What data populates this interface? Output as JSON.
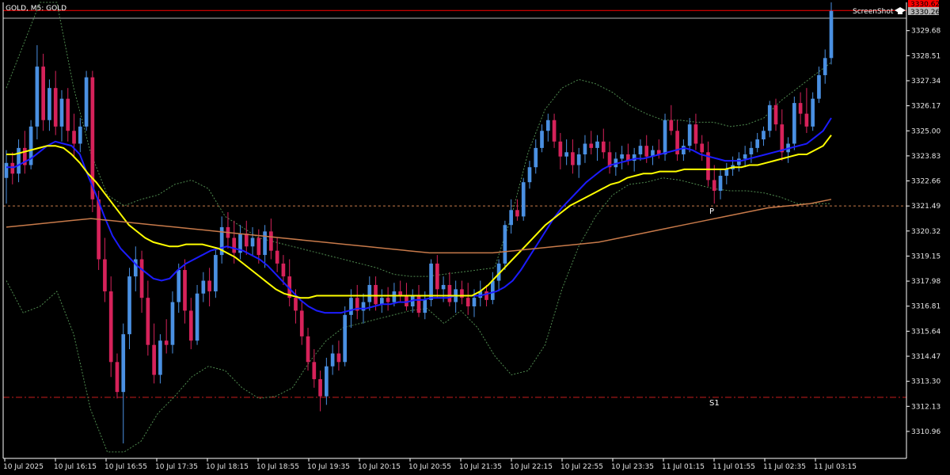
{
  "symbol_label": "GOLD, M5:  GOLD",
  "brand_label": "ScreenShot",
  "icon": "graduation-cap-icon",
  "colors": {
    "background": "#000000",
    "bull": "#4a90e2",
    "bear": "#d6225a",
    "axis": "#ffffff",
    "ma_fast": "#1c1cff",
    "ma_slow": "#ffff00",
    "ma_long": "#c87a4a",
    "bollinger": "#4f8a4f",
    "level_p": "#c87a4a",
    "level_s1": "#c81e1e",
    "bid_line": "#b4b4b4",
    "ask_line": "#ff0000"
  },
  "current_price": {
    "bid": "3330.26",
    "ask": "3330.62"
  },
  "chart_data": {
    "type": "candlestick",
    "instrument": "GOLD",
    "timeframe": "M5",
    "y_ticks": [
      "3329.68",
      "3328.51",
      "3327.34",
      "3326.17",
      "3325.00",
      "3323.83",
      "3322.66",
      "3321.49",
      "3320.32",
      "3319.15",
      "3317.98",
      "3316.81",
      "3315.64",
      "3314.47",
      "3313.30",
      "3312.13",
      "3310.96"
    ],
    "ylim": [
      3309.7,
      3331.0
    ],
    "x_ticks": [
      "10 Jul 2025",
      "10 Jul 16:15",
      "10 Jul 16:55",
      "10 Jul 17:35",
      "10 Jul 18:15",
      "10 Jul 18:55",
      "10 Jul 19:35",
      "10 Jul 20:15",
      "10 Jul 20:55",
      "10 Jul 21:35",
      "10 Jul 22:15",
      "10 Jul 22:55",
      "10 Jul 23:35",
      "11 Jul 01:15",
      "11 Jul 01:55",
      "11 Jul 02:35",
      "11 Jul 03:15"
    ],
    "levels": [
      {
        "label": "P",
        "value": 3321.49,
        "style": "dashed"
      },
      {
        "label": "S1",
        "value": 3312.55,
        "style": "dashdot"
      }
    ],
    "candles": [
      [
        3322.8,
        3324.1,
        3321.6,
        3323.5
      ],
      [
        3323.5,
        3324.0,
        3322.5,
        3323.0
      ],
      [
        3323.0,
        3324.6,
        3322.6,
        3324.2
      ],
      [
        3324.2,
        3325.0,
        3323.0,
        3323.4
      ],
      [
        3323.4,
        3325.5,
        3323.2,
        3325.2
      ],
      [
        3325.2,
        3329.0,
        3324.6,
        3328.0
      ],
      [
        3328.0,
        3328.6,
        3325.0,
        3325.5
      ],
      [
        3325.5,
        3327.4,
        3325.0,
        3327.0
      ],
      [
        3327.0,
        3327.8,
        3324.8,
        3325.2
      ],
      [
        3325.2,
        3326.9,
        3324.5,
        3326.5
      ],
      [
        3326.5,
        3327.0,
        3324.5,
        3325.0
      ],
      [
        3325.0,
        3325.8,
        3323.8,
        3324.4
      ],
      [
        3324.4,
        3325.6,
        3324.0,
        3325.2
      ],
      [
        3325.2,
        3327.8,
        3325.0,
        3327.5
      ],
      [
        3327.5,
        3327.8,
        3321.2,
        3321.8
      ],
      [
        3321.8,
        3322.2,
        3318.5,
        3319.0
      ],
      [
        3319.0,
        3320.0,
        3317.0,
        3317.5
      ],
      [
        3317.5,
        3318.2,
        3313.5,
        3314.2
      ],
      [
        3314.2,
        3314.6,
        3312.5,
        3312.8
      ],
      [
        3312.8,
        3316.0,
        3310.4,
        3315.5
      ],
      [
        3315.5,
        3318.6,
        3314.8,
        3318.2
      ],
      [
        3318.2,
        3319.6,
        3317.5,
        3319.0
      ],
      [
        3319.0,
        3319.4,
        3316.5,
        3317.2
      ],
      [
        3317.2,
        3318.0,
        3314.5,
        3315.0
      ],
      [
        3315.0,
        3316.0,
        3313.2,
        3313.6
      ],
      [
        3313.6,
        3315.5,
        3313.2,
        3315.2
      ],
      [
        3315.2,
        3316.2,
        3314.6,
        3315.0
      ],
      [
        3315.0,
        3317.5,
        3314.6,
        3317.0
      ],
      [
        3317.0,
        3318.8,
        3316.5,
        3318.5
      ],
      [
        3318.5,
        3319.0,
        3316.0,
        3316.6
      ],
      [
        3316.6,
        3317.2,
        3314.8,
        3315.2
      ],
      [
        3315.2,
        3317.8,
        3315.0,
        3317.4
      ],
      [
        3317.4,
        3318.4,
        3317.0,
        3318.0
      ],
      [
        3318.0,
        3318.6,
        3316.8,
        3317.5
      ],
      [
        3317.5,
        3319.5,
        3317.2,
        3319.2
      ],
      [
        3319.2,
        3321.0,
        3318.8,
        3320.5
      ],
      [
        3320.5,
        3321.2,
        3319.5,
        3320.0
      ],
      [
        3320.0,
        3320.8,
        3318.8,
        3319.3
      ],
      [
        3319.3,
        3320.6,
        3319.0,
        3320.2
      ],
      [
        3320.2,
        3320.8,
        3319.2,
        3319.6
      ],
      [
        3319.6,
        3320.5,
        3319.2,
        3320.0
      ],
      [
        3320.0,
        3320.4,
        3318.8,
        3319.2
      ],
      [
        3319.2,
        3320.6,
        3318.6,
        3320.3
      ],
      [
        3320.3,
        3320.9,
        3319.0,
        3319.4
      ],
      [
        3319.4,
        3320.0,
        3318.4,
        3318.8
      ],
      [
        3318.8,
        3319.2,
        3317.8,
        3318.2
      ],
      [
        3318.2,
        3319.0,
        3316.8,
        3317.2
      ],
      [
        3317.2,
        3317.6,
        3316.0,
        3316.6
      ],
      [
        3316.6,
        3317.0,
        3315.0,
        3315.4
      ],
      [
        3315.4,
        3315.8,
        3313.8,
        3314.2
      ],
      [
        3314.2,
        3314.8,
        3313.0,
        3313.4
      ],
      [
        3313.4,
        3313.8,
        3311.9,
        3312.6
      ],
      [
        3312.6,
        3314.4,
        3312.2,
        3314.0
      ],
      [
        3314.0,
        3315.0,
        3313.6,
        3314.6
      ],
      [
        3314.6,
        3315.2,
        3313.8,
        3314.2
      ],
      [
        3314.2,
        3316.8,
        3314.0,
        3316.4
      ],
      [
        3316.4,
        3317.6,
        3315.8,
        3317.2
      ],
      [
        3317.2,
        3317.8,
        3316.2,
        3316.6
      ],
      [
        3316.6,
        3317.4,
        3316.0,
        3317.0
      ],
      [
        3317.0,
        3318.2,
        3316.6,
        3317.8
      ],
      [
        3317.8,
        3318.2,
        3316.6,
        3316.9
      ],
      [
        3316.9,
        3317.6,
        3316.5,
        3317.2
      ],
      [
        3317.2,
        3317.7,
        3316.6,
        3317.0
      ],
      [
        3317.0,
        3317.9,
        3316.8,
        3317.5
      ],
      [
        3317.5,
        3318.0,
        3317.0,
        3317.3
      ],
      [
        3317.3,
        3317.9,
        3316.6,
        3316.8
      ],
      [
        3316.8,
        3317.6,
        3316.5,
        3317.3
      ],
      [
        3317.3,
        3317.8,
        3316.3,
        3316.5
      ],
      [
        3316.5,
        3317.5,
        3316.2,
        3317.1
      ],
      [
        3317.1,
        3319.0,
        3316.8,
        3318.8
      ],
      [
        3318.8,
        3319.2,
        3317.2,
        3317.6
      ],
      [
        3317.6,
        3318.2,
        3317.0,
        3317.8
      ],
      [
        3317.8,
        3318.4,
        3316.8,
        3317.0
      ],
      [
        3317.0,
        3318.0,
        3316.5,
        3317.6
      ],
      [
        3317.6,
        3318.0,
        3316.9,
        3317.2
      ],
      [
        3317.2,
        3317.9,
        3316.4,
        3316.8
      ],
      [
        3316.8,
        3317.6,
        3316.3,
        3317.2
      ],
      [
        3317.2,
        3318.0,
        3316.8,
        3317.5
      ],
      [
        3317.5,
        3317.8,
        3316.8,
        3317.1
      ],
      [
        3317.1,
        3318.4,
        3316.9,
        3318.0
      ],
      [
        3318.0,
        3319.0,
        3317.5,
        3318.8
      ],
      [
        3318.8,
        3320.8,
        3318.5,
        3320.6
      ],
      [
        3320.6,
        3321.8,
        3320.2,
        3321.3
      ],
      [
        3321.3,
        3321.8,
        3320.8,
        3321.0
      ],
      [
        3321.0,
        3322.8,
        3320.8,
        3322.6
      ],
      [
        3322.6,
        3323.6,
        3322.3,
        3323.3
      ],
      [
        3323.3,
        3324.6,
        3323.0,
        3324.2
      ],
      [
        3324.2,
        3325.3,
        3324.0,
        3325.0
      ],
      [
        3325.0,
        3325.8,
        3324.5,
        3325.5
      ],
      [
        3325.5,
        3325.8,
        3324.2,
        3324.5
      ],
      [
        3324.5,
        3324.9,
        3323.2,
        3323.8
      ],
      [
        3323.8,
        3324.6,
        3323.4,
        3324.0
      ],
      [
        3324.0,
        3324.6,
        3323.0,
        3323.4
      ],
      [
        3323.4,
        3324.2,
        3322.8,
        3323.9
      ],
      [
        3323.9,
        3324.8,
        3323.5,
        3324.4
      ],
      [
        3324.4,
        3325.0,
        3323.9,
        3324.2
      ],
      [
        3324.2,
        3324.8,
        3323.6,
        3324.5
      ],
      [
        3324.5,
        3325.1,
        3323.7,
        3324.0
      ],
      [
        3324.0,
        3324.5,
        3323.0,
        3323.3
      ],
      [
        3323.3,
        3324.0,
        3322.9,
        3323.7
      ],
      [
        3323.7,
        3324.3,
        3323.2,
        3323.9
      ],
      [
        3323.9,
        3324.4,
        3323.4,
        3323.6
      ],
      [
        3323.6,
        3324.2,
        3323.1,
        3323.9
      ],
      [
        3323.9,
        3324.6,
        3323.6,
        3324.3
      ],
      [
        3324.3,
        3324.8,
        3323.5,
        3323.8
      ],
      [
        3323.8,
        3324.3,
        3323.4,
        3324.1
      ],
      [
        3324.1,
        3324.6,
        3323.7,
        3323.9
      ],
      [
        3323.9,
        3325.8,
        3323.6,
        3325.5
      ],
      [
        3325.5,
        3326.2,
        3324.8,
        3325.0
      ],
      [
        3325.0,
        3325.5,
        3323.6,
        3323.9
      ],
      [
        3323.9,
        3324.6,
        3323.6,
        3324.3
      ],
      [
        3324.3,
        3325.6,
        3324.0,
        3325.3
      ],
      [
        3325.3,
        3325.8,
        3324.1,
        3324.4
      ],
      [
        3324.4,
        3324.8,
        3323.6,
        3324.0
      ],
      [
        3324.0,
        3324.5,
        3322.4,
        3322.7
      ],
      [
        3322.7,
        3323.4,
        3321.6,
        3322.2
      ],
      [
        3322.2,
        3323.2,
        3321.8,
        3322.9
      ],
      [
        3322.9,
        3323.5,
        3322.5,
        3323.2
      ],
      [
        3323.2,
        3323.8,
        3322.9,
        3323.4
      ],
      [
        3323.4,
        3324.0,
        3323.1,
        3323.7
      ],
      [
        3323.7,
        3324.3,
        3323.3,
        3323.9
      ],
      [
        3323.9,
        3324.5,
        3323.5,
        3324.2
      ],
      [
        3324.2,
        3324.9,
        3324.0,
        3324.6
      ],
      [
        3324.6,
        3325.2,
        3324.3,
        3325.0
      ],
      [
        3325.0,
        3326.4,
        3324.7,
        3326.2
      ],
      [
        3326.2,
        3326.5,
        3325.0,
        3325.3
      ],
      [
        3325.3,
        3326.0,
        3323.6,
        3324.0
      ],
      [
        3324.0,
        3324.7,
        3323.5,
        3324.4
      ],
      [
        3324.4,
        3326.6,
        3324.1,
        3326.3
      ],
      [
        3326.3,
        3326.8,
        3325.3,
        3325.8
      ],
      [
        3325.8,
        3327.0,
        3324.9,
        3325.2
      ],
      [
        3325.2,
        3326.8,
        3325.0,
        3326.5
      ],
      [
        3326.5,
        3328.0,
        3326.3,
        3327.6
      ],
      [
        3327.6,
        3328.8,
        3327.2,
        3328.4
      ],
      [
        3328.4,
        3331.0,
        3328.1,
        3330.6
      ]
    ],
    "indicators": [
      {
        "name": "ma_fast",
        "values": [
          3323.3,
          3323.3,
          3323.5,
          3323.7,
          3324.0,
          3324.3,
          3324.5,
          3324.4,
          3324.3,
          3323.9,
          3322.9,
          3322.0,
          3321.0,
          3320.1,
          3319.5,
          3319.1,
          3318.7,
          3318.4,
          3318.1,
          3318.0,
          3318.1,
          3318.5,
          3318.8,
          3319.0,
          3319.2,
          3319.4,
          3319.5,
          3319.6,
          3319.5,
          3319.4,
          3319.2,
          3319.0,
          3318.7,
          3318.3,
          3317.9,
          3317.5,
          3317.1,
          3316.8,
          3316.6,
          3316.5,
          3316.5,
          3316.5,
          3316.6,
          3316.7,
          3316.7,
          3316.8,
          3316.9,
          3316.9,
          3317.0,
          3317.0,
          3317.1,
          3317.1,
          3317.2,
          3317.2,
          3317.2,
          3317.3,
          3317.3,
          3317.3,
          3317.3,
          3317.4,
          3317.5,
          3317.7,
          3318.0,
          3318.5,
          3319.1,
          3319.7,
          3320.3,
          3320.9,
          3321.4,
          3321.8,
          3322.2,
          3322.6,
          3322.9,
          3323.2,
          3323.4,
          3323.5,
          3323.6,
          3323.7,
          3323.7,
          3323.8,
          3323.9,
          3324.0,
          3324.1,
          3324.2,
          3324.1,
          3323.9,
          3323.8,
          3323.7,
          3323.6,
          3323.6,
          3323.6,
          3323.7,
          3323.8,
          3323.9,
          3324.0,
          3324.1,
          3324.2,
          3324.3,
          3324.4,
          3324.7,
          3325.0,
          3325.6
        ]
      },
      {
        "name": "ma_slow",
        "values": [
          3323.9,
          3323.9,
          3324.0,
          3324.1,
          3324.2,
          3324.3,
          3324.3,
          3324.2,
          3323.9,
          3323.5,
          3323.0,
          3322.6,
          3322.1,
          3321.6,
          3321.1,
          3320.6,
          3320.3,
          3320.0,
          3319.8,
          3319.7,
          3319.6,
          3319.6,
          3319.7,
          3319.7,
          3319.7,
          3319.6,
          3319.5,
          3319.3,
          3319.1,
          3318.8,
          3318.5,
          3318.2,
          3317.9,
          3317.6,
          3317.4,
          3317.3,
          3317.2,
          3317.2,
          3317.3,
          3317.3,
          3317.3,
          3317.3,
          3317.3,
          3317.3,
          3317.3,
          3317.3,
          3317.3,
          3317.3,
          3317.3,
          3317.3,
          3317.3,
          3317.3,
          3317.3,
          3317.3,
          3317.3,
          3317.3,
          3317.3,
          3317.3,
          3317.5,
          3317.8,
          3318.2,
          3318.6,
          3319.0,
          3319.4,
          3319.8,
          3320.2,
          3320.6,
          3320.9,
          3321.2,
          3321.5,
          3321.7,
          3321.9,
          3322.1,
          3322.3,
          3322.5,
          3322.6,
          3322.8,
          3322.9,
          3323.0,
          3323.0,
          3323.1,
          3323.1,
          3323.1,
          3323.2,
          3323.2,
          3323.2,
          3323.2,
          3323.2,
          3323.2,
          3323.3,
          3323.3,
          3323.4,
          3323.4,
          3323.5,
          3323.6,
          3323.7,
          3323.8,
          3323.9,
          3323.9,
          3324.1,
          3324.3,
          3324.8
        ]
      },
      {
        "name": "ma_long",
        "values": [
          3320.5,
          3320.6,
          3320.7,
          3320.8,
          3320.9,
          3320.8,
          3320.7,
          3320.6,
          3320.5,
          3320.4,
          3320.3,
          3320.2,
          3320.1,
          3320.0,
          3319.9,
          3319.8,
          3319.7,
          3319.6,
          3319.5,
          3319.4,
          3319.3,
          3319.3,
          3319.3,
          3319.3,
          3319.4,
          3319.5,
          3319.6,
          3319.7,
          3319.8,
          3320.0,
          3320.2,
          3320.4,
          3320.6,
          3320.8,
          3321.0,
          3321.2,
          3321.4,
          3321.5,
          3321.6,
          3321.8
        ]
      },
      {
        "name": "bollinger_upper",
        "values": [
          3327.0,
          3329.0,
          3331.0,
          3331.0,
          3327.0,
          3324.0,
          3322.0,
          3321.5,
          3321.8,
          3322.0,
          3322.5,
          3322.7,
          3322.3,
          3321.0,
          3320.5,
          3320.0,
          3319.8,
          3319.6,
          3319.4,
          3319.2,
          3319.0,
          3318.8,
          3318.6,
          3318.3,
          3318.2,
          3318.2,
          3318.3,
          3318.4,
          3318.5,
          3318.6,
          3321.0,
          3324.0,
          3326.0,
          3327.0,
          3327.4,
          3327.2,
          3326.8,
          3326.2,
          3325.8,
          3325.5,
          3325.5,
          3325.4,
          3325.4,
          3325.2,
          3325.3,
          3325.6,
          3326.4,
          3327.0,
          3327.6,
          3328.2
        ]
      },
      {
        "name": "bollinger_lower",
        "values": [
          3318.0,
          3316.5,
          3316.8,
          3317.5,
          3315.5,
          3312.0,
          3310.0,
          3310.0,
          3310.5,
          3311.8,
          3312.6,
          3313.5,
          3314.0,
          3313.8,
          3313.0,
          3312.5,
          3312.6,
          3313.0,
          3314.2,
          3315.2,
          3315.8,
          3316.0,
          3316.2,
          3316.4,
          3316.6,
          3316.7,
          3316.0,
          3316.6,
          3315.8,
          3314.5,
          3313.6,
          3313.8,
          3315.0,
          3317.6,
          3319.6,
          3321.0,
          3322.0,
          3322.5,
          3322.6,
          3322.8,
          3322.7,
          3322.5,
          3322.3,
          3322.2,
          3322.2,
          3322.1,
          3321.9,
          3321.6,
          3321.6,
          3321.6
        ]
      }
    ]
  }
}
